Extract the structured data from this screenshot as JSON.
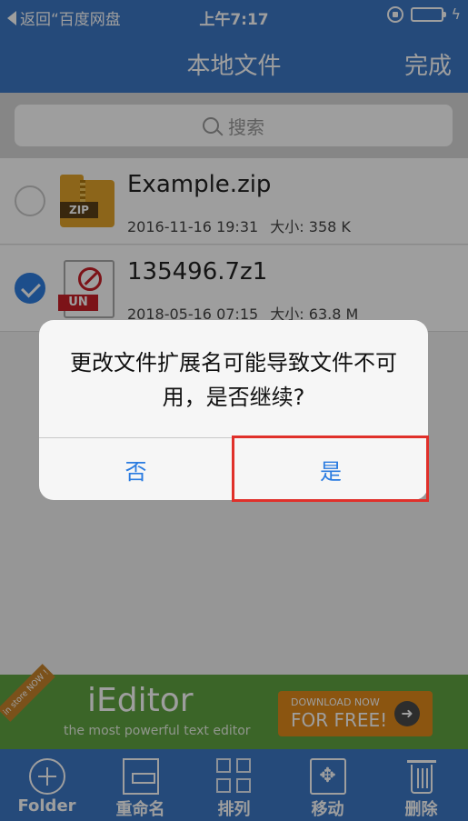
{
  "status_bar": {
    "back_text": "返回“百度网盘",
    "time": "上午7:17",
    "icons": [
      "back-arrow-icon",
      "orientation-lock-icon",
      "battery-icon",
      "charging-bolt-icon"
    ]
  },
  "nav": {
    "title": "本地文件",
    "done_label": "完成"
  },
  "search": {
    "placeholder": "搜索"
  },
  "files": [
    {
      "name": "Example.zip",
      "date": "2016-11-16 19:31",
      "size": "大小: 358 K",
      "badge": "ZIP",
      "checked": false
    },
    {
      "name": "135496.7z1",
      "date": "2018-05-16 07:15",
      "size": "大小: 63.8 M",
      "badge": "UN",
      "checked": true
    }
  ],
  "alert": {
    "message": "更改文件扩展名可能导致文件不可用，是否继续?",
    "no_label": "否",
    "yes_label": "是"
  },
  "ad": {
    "corner": "in store NOW !",
    "brand": "iEditor",
    "tagline": "the most powerful text editor",
    "cta_small": "DOWNLOAD NOW",
    "cta_big": "FOR FREE!"
  },
  "toolbar": {
    "items": [
      {
        "label": "Folder",
        "icon": "add-folder-icon"
      },
      {
        "label": "重命名",
        "icon": "rename-icon"
      },
      {
        "label": "排列",
        "icon": "grid-sort-icon"
      },
      {
        "label": "移动",
        "icon": "move-icon"
      },
      {
        "label": "删除",
        "icon": "trash-icon"
      }
    ]
  },
  "colors": {
    "bar_blue": "#3d78c5",
    "accent_blue": "#2a7be0",
    "highlight_red": "#e0302a",
    "ad_green": "#5fa342",
    "cta_orange": "#e08a1a"
  }
}
